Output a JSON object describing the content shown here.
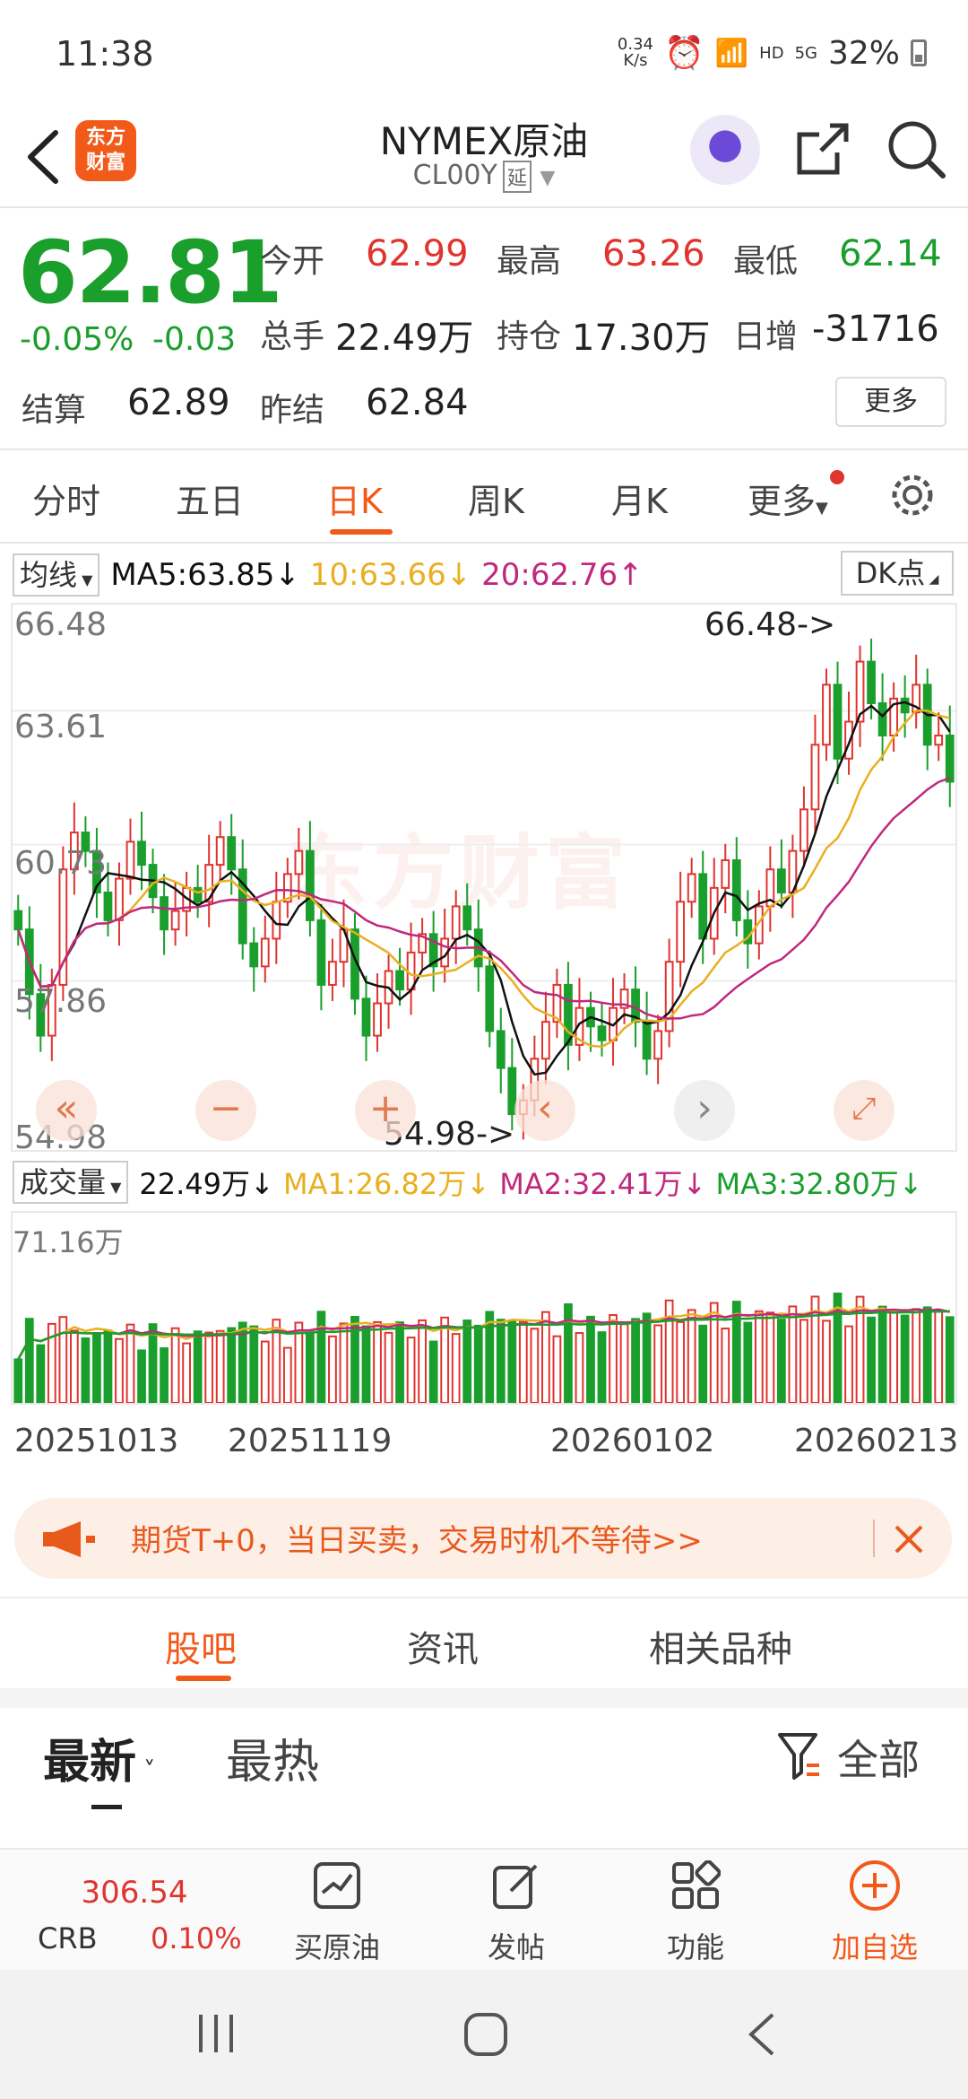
{
  "status_bar": {
    "time": "11:38",
    "speed": "0.34",
    "speed_unit": "K/s",
    "hd": "HD",
    "signal": "5G",
    "battery": "32%"
  },
  "header": {
    "title": "NYMEX原油",
    "code": "CL00Y",
    "badge": "延",
    "logo_line1": "东方",
    "logo_line2": "财富"
  },
  "quote": {
    "price": "62.81",
    "change_pct": "-0.05%",
    "change": "-0.03",
    "open_label": "今开",
    "open": "62.99",
    "high_label": "最高",
    "high": "63.26",
    "low_label": "最低",
    "low": "62.14",
    "volume_label": "总手",
    "volume": "22.49万",
    "oi_label": "持仓",
    "oi": "17.30万",
    "daily_inc_label": "日增",
    "daily_inc": "-31716",
    "settle_label": "结算",
    "settle": "62.89",
    "prev_settle_label": "昨结",
    "prev_settle": "62.84",
    "more_button": "更多"
  },
  "chart_tabs": {
    "items": [
      "分时",
      "五日",
      "日K",
      "周K",
      "月K",
      "更多"
    ],
    "active": "日K"
  },
  "ma_legend": {
    "selector": "均线",
    "ma5": "MA5:63.85",
    "ma10": "10:63.66",
    "ma20": "20:62.76",
    "dk_button": "DK点"
  },
  "volume_legend": {
    "selector": "成交量",
    "vol": "22.49万",
    "ma1": "MA1:26.82万",
    "ma2": "MA2:32.41万",
    "ma3": "MA3:32.80万"
  },
  "chart_data": {
    "type": "candlestick",
    "y_ticks": [
      "66.48",
      "63.61",
      "60.73",
      "57.86",
      "54.98"
    ],
    "ylim": [
      54.98,
      66.48
    ],
    "high_marker": "66.48->",
    "low_marker": "54.98->",
    "volume_max_label": "71.16万",
    "x_ticks": [
      "20251013",
      "20251119",
      "20260102",
      "20260213"
    ],
    "watermark": "东方财富",
    "ma_colors": {
      "ma5": "#111111",
      "ma10": "#e8b020",
      "ma20": "#c0287e"
    },
    "closes": [
      59.6,
      58.2,
      57.3,
      58.4,
      60.9,
      61.7,
      61.3,
      60.4,
      59.8,
      60.7,
      61.5,
      61.0,
      60.3,
      59.6,
      60.0,
      60.5,
      60.2,
      61.0,
      61.6,
      60.9,
      59.3,
      58.8,
      59.4,
      60.2,
      60.8,
      61.3,
      59.8,
      58.4,
      58.9,
      59.6,
      58.1,
      57.3,
      58.0,
      58.7,
      58.3,
      59.1,
      59.5,
      58.8,
      59.4,
      60.1,
      59.6,
      58.8,
      57.4,
      56.6,
      55.6,
      55.9,
      56.8,
      57.6,
      58.4,
      57.1,
      57.9,
      57.5,
      57.2,
      57.9,
      58.3,
      57.6,
      56.8,
      57.4,
      58.9,
      60.2,
      60.8,
      59.4,
      60.5,
      61.1,
      59.8,
      59.3,
      60.1,
      60.9,
      60.4,
      61.3,
      62.2,
      63.6,
      64.9,
      63.3,
      64.1,
      65.4,
      64.5,
      63.8,
      64.6,
      64.3,
      64.9,
      63.6,
      63.8,
      62.8
    ]
  },
  "promo": {
    "text": "期货T+0，当日买卖，交易时机不等待>>"
  },
  "bottom_tabs": {
    "items": [
      "股吧",
      "资讯",
      "相关品种"
    ],
    "active": "股吧"
  },
  "feed_filters": {
    "newest": "最新",
    "hottest": "最热",
    "all": "全部"
  },
  "bottom_bar": {
    "crb_value": "306.54",
    "crb_label": "CRB",
    "crb_pct": "0.10%",
    "buy": "买原油",
    "post": "发帖",
    "func": "功能",
    "add": "加自选"
  },
  "colors": {
    "accent": "#f25a1a",
    "up": "#e0342f",
    "down": "#1a9e2c"
  }
}
